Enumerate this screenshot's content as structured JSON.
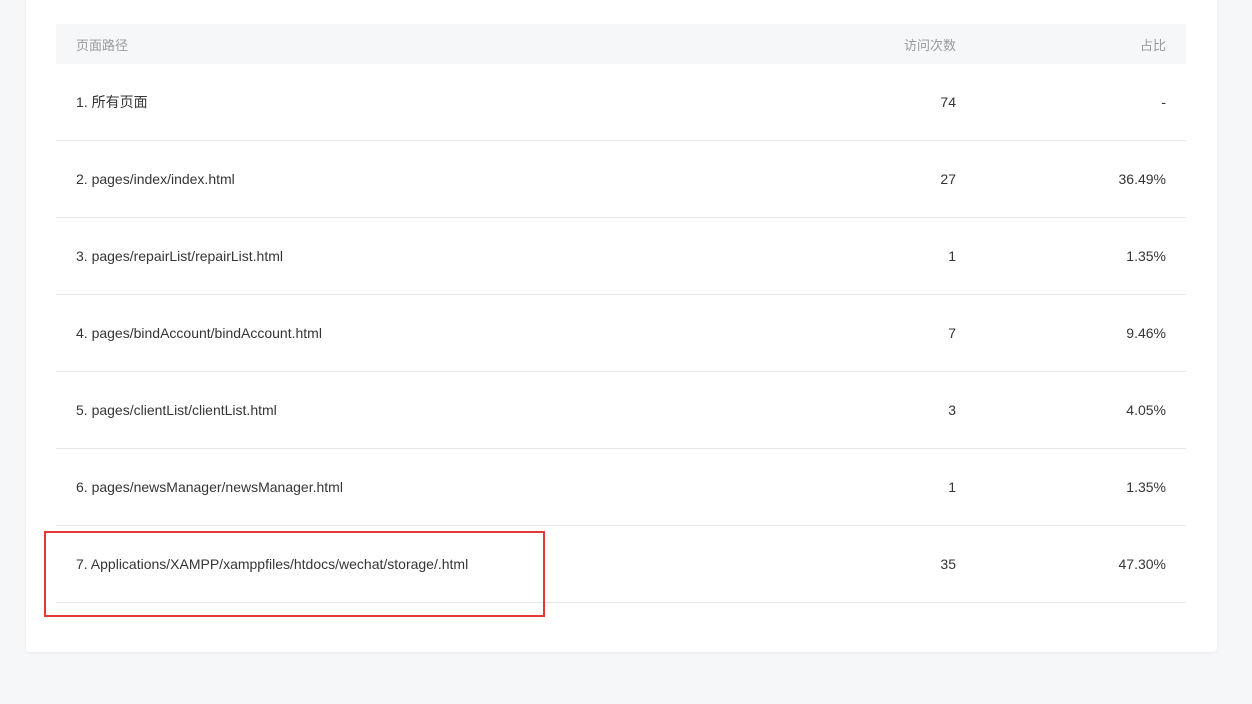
{
  "table": {
    "headers": {
      "path": "页面路径",
      "visits": "访问次数",
      "ratio": "占比"
    },
    "rows": [
      {
        "path": "1. 所有页面",
        "visits": "74",
        "ratio": "-"
      },
      {
        "path": "2. pages/index/index.html",
        "visits": "27",
        "ratio": "36.49%"
      },
      {
        "path": "3. pages/repairList/repairList.html",
        "visits": "1",
        "ratio": "1.35%"
      },
      {
        "path": "4. pages/bindAccount/bindAccount.html",
        "visits": "7",
        "ratio": "9.46%"
      },
      {
        "path": "5. pages/clientList/clientList.html",
        "visits": "3",
        "ratio": "4.05%"
      },
      {
        "path": "6. pages/newsManager/newsManager.html",
        "visits": "1",
        "ratio": "1.35%"
      },
      {
        "path": "7. Applications/XAMPP/xamppfiles/htdocs/wechat/storage/.html",
        "visits": "35",
        "ratio": "47.30%"
      }
    ]
  },
  "colors": {
    "highlight": "#e53935",
    "header_bg": "#f6f7f9"
  }
}
